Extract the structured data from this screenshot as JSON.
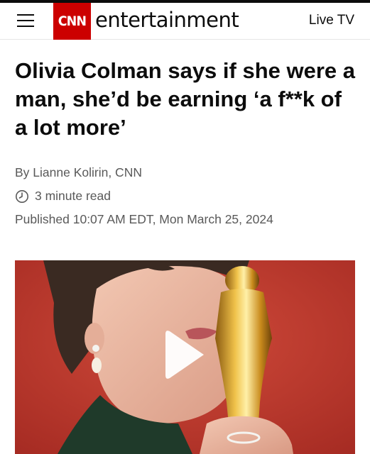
{
  "header": {
    "menu_icon": "hamburger-menu-icon",
    "logo_text": "CNN",
    "section": "entertainment",
    "live_tv": "Live TV",
    "brand_color": "#cc0000"
  },
  "article": {
    "headline": "Olivia Colman says if she were a man, she’d be earning ‘a f**k of a lot more’",
    "byline": "By Lianne Kolirin, CNN",
    "read_time": "3 minute read",
    "read_time_icon": "clock-icon",
    "published": "Published 10:07 AM EDT, Mon March 25, 2024"
  },
  "video": {
    "play_icon": "play-icon",
    "background_color": "#c0392b"
  }
}
